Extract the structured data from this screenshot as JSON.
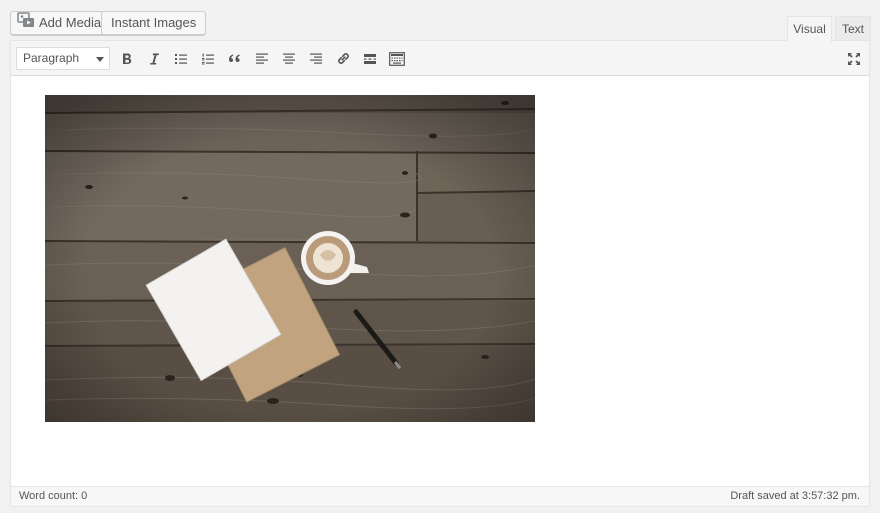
{
  "media_buttons": {
    "add_media_label": "Add Media",
    "instant_images_label": "Instant Images"
  },
  "tabs": {
    "visual_label": "Visual",
    "text_label": "Text",
    "active": "Visual"
  },
  "toolbar": {
    "format_select_value": "Paragraph",
    "buttons": [
      "bold-icon",
      "italic-icon",
      "bullet-list-icon",
      "numbered-list-icon",
      "blockquote-icon",
      "align-left-icon",
      "align-center-icon",
      "align-right-icon",
      "link-icon",
      "read-more-icon",
      "toolbar-toggle-icon",
      "fullscreen-icon"
    ]
  },
  "content": {
    "image_subject": "wood-table-notebook-coffee-pen"
  },
  "status": {
    "word_count": "Word count: 0",
    "draft_saved": "Draft saved at 3:57:32 pm."
  },
  "colors": {
    "background": "#f1f1f1",
    "toolbar": "#f5f5f5",
    "editor": "#ffffff",
    "text": "#555555"
  }
}
